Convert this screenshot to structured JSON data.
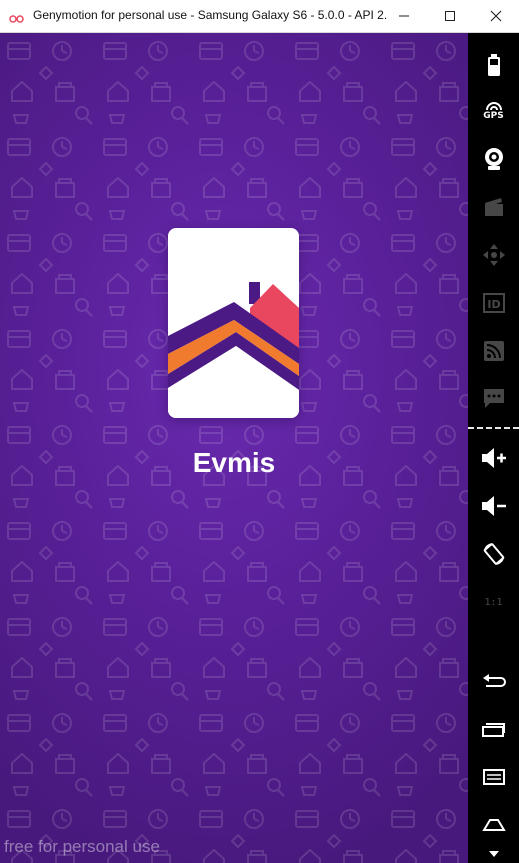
{
  "window": {
    "title": "Genymotion for personal use - Samsung Galaxy S6 - 5.0.0 - API 2...",
    "app_icon": "genymotion-logo-icon",
    "controls": [
      "minimize-icon",
      "maximize-icon",
      "close-icon"
    ]
  },
  "screen": {
    "app_name": "Evmis",
    "watermark": "free for personal use",
    "colors": {
      "background": "#5a209a",
      "logo_orange": "#f07a2e",
      "logo_red": "#e8475f",
      "logo_purple": "#4c1a85",
      "text": "#ffffff"
    }
  },
  "sidebar": {
    "items": [
      {
        "icon": "battery-icon"
      },
      {
        "icon": "gps-icon",
        "label": "GPS"
      },
      {
        "icon": "webcam-icon"
      },
      {
        "icon": "media-clapper-icon"
      },
      {
        "icon": "move-dpad-icon"
      },
      {
        "icon": "identifiers-icon",
        "label": "ID"
      },
      {
        "icon": "network-icon"
      },
      {
        "icon": "sms-icon"
      },
      {
        "icon": "volume-up-icon"
      },
      {
        "icon": "volume-down-icon"
      },
      {
        "icon": "rotate-icon"
      },
      {
        "icon": "pixel-perfect-icon",
        "label": "1:1"
      },
      {
        "icon": "back-icon"
      },
      {
        "icon": "recent-apps-icon"
      },
      {
        "icon": "menu-icon"
      },
      {
        "icon": "home-icon"
      }
    ]
  }
}
